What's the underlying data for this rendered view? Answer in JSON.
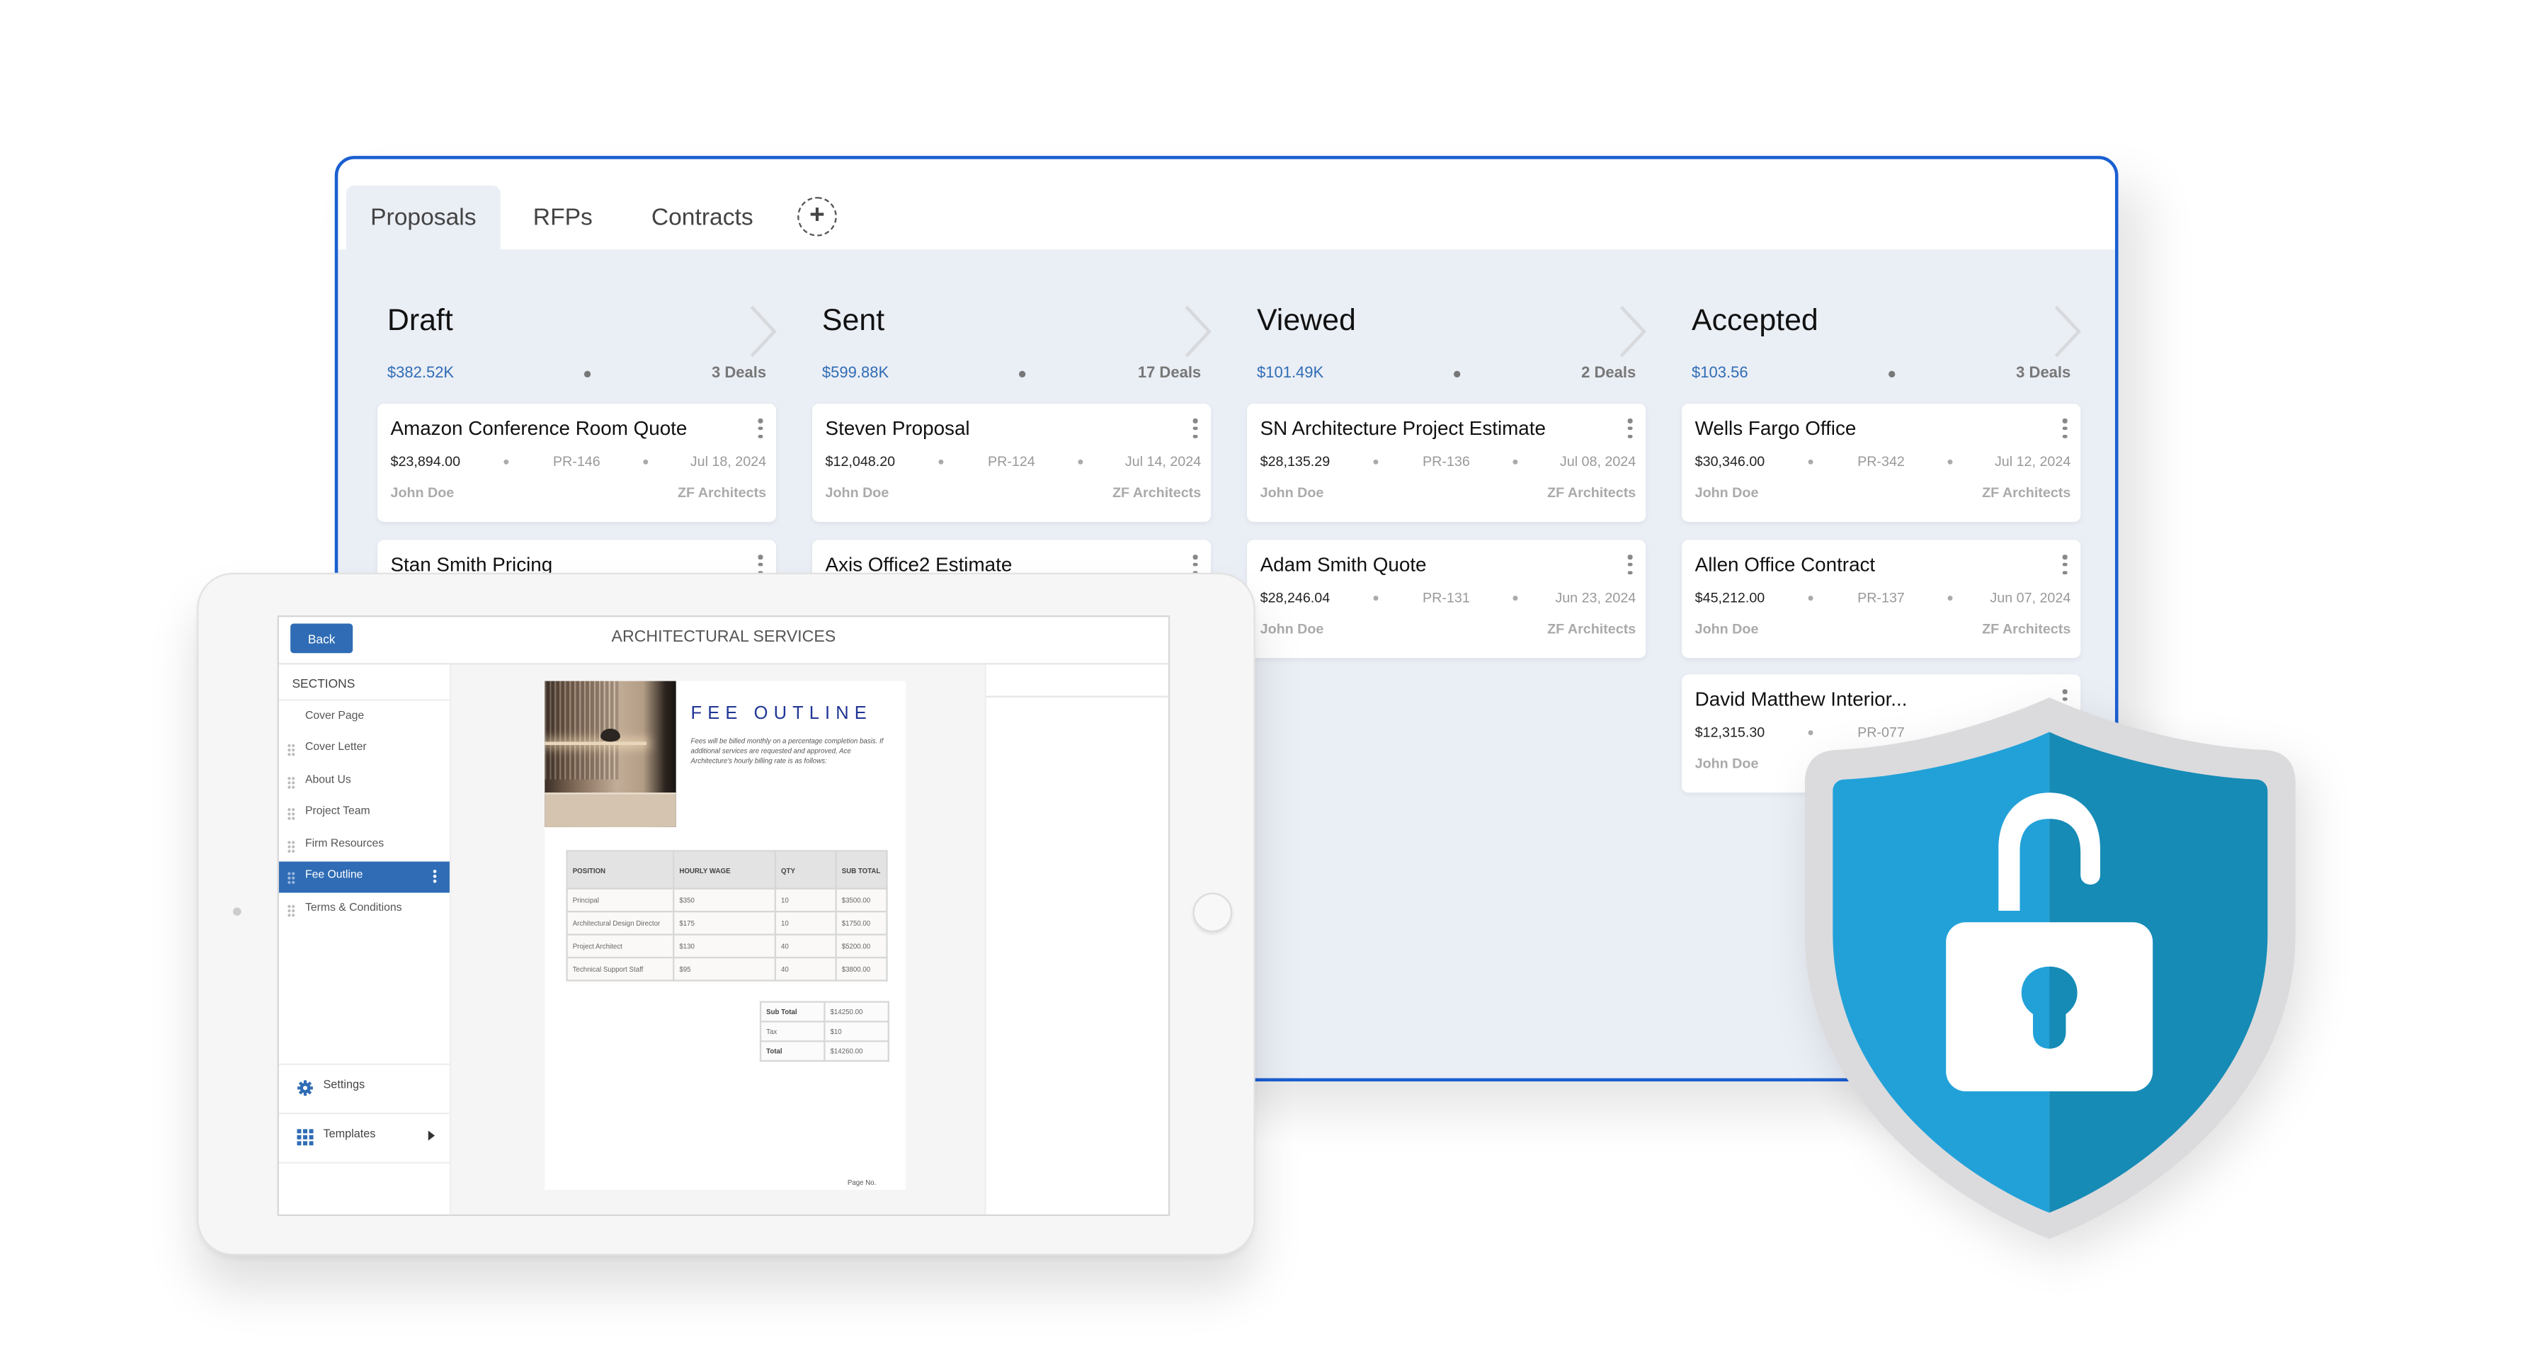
{
  "board": {
    "tabs": [
      {
        "label": "Proposals",
        "active": true
      },
      {
        "label": "RFPs",
        "active": false
      },
      {
        "label": "Contracts",
        "active": false
      }
    ],
    "add_tab_icon": "plus-circle-dashed-icon",
    "columns": [
      {
        "title": "Draft",
        "total": "$382.52K",
        "count": "3 Deals",
        "cards": [
          {
            "title": "Amazon Conference Room Quote",
            "amount": "$23,894.00",
            "code": "PR-146",
            "date": "Jul 18, 2024",
            "owner": "John Doe",
            "company": "ZF Architects"
          },
          {
            "title": "Stan Smith Pricing"
          }
        ]
      },
      {
        "title": "Sent",
        "total": "$599.88K",
        "count": "17 Deals",
        "cards": [
          {
            "title": "Steven Proposal",
            "amount": "$12,048.20",
            "code": "PR-124",
            "date": "Jul 14, 2024",
            "owner": "John Doe",
            "company": "ZF Architects"
          },
          {
            "title": "Axis Office2 Estimate"
          }
        ]
      },
      {
        "title": "Viewed",
        "total": "$101.49K",
        "count": "2 Deals",
        "cards": [
          {
            "title": "SN Architecture Project Estimate",
            "amount": "$28,135.29",
            "code": "PR-136",
            "date": "Jul 08, 2024",
            "owner": "John Doe",
            "company": "ZF Architects"
          },
          {
            "title": "Adam Smith Quote",
            "amount": "$28,246.04",
            "code": "PR-131",
            "date": "Jun 23, 2024",
            "owner": "John Doe",
            "company": "ZF Architects"
          }
        ]
      },
      {
        "title": "Accepted",
        "total": "$103.56",
        "count": "3 Deals",
        "cards": [
          {
            "title": "Wells Fargo Office",
            "amount": "$30,346.00",
            "code": "PR-342",
            "date": "Jul 12, 2024",
            "owner": "John Doe",
            "company": "ZF Architects"
          },
          {
            "title": "Allen Office Contract",
            "amount": "$45,212.00",
            "code": "PR-137",
            "date": "Jun 07, 2024",
            "owner": "John Doe",
            "company": "ZF Architects"
          },
          {
            "title": "David Matthew Interior...",
            "amount": "$12,315.30",
            "code": "PR-077",
            "owner": "John Doe"
          }
        ]
      }
    ]
  },
  "editor": {
    "back_label": "Back",
    "title": "ARCHITECTURAL SERVICES",
    "sections_label": "SECTIONS",
    "sections": [
      {
        "label": "Cover Page",
        "draggable": false
      },
      {
        "label": "Cover Letter",
        "draggable": true
      },
      {
        "label": "About Us",
        "draggable": true
      },
      {
        "label": "Project Team",
        "draggable": true
      },
      {
        "label": "Firm Resources",
        "draggable": true
      },
      {
        "label": "Fee Outline",
        "draggable": true,
        "active": true
      },
      {
        "label": "Terms & Conditions",
        "draggable": true
      }
    ],
    "settings_label": "Settings",
    "templates_label": "Templates",
    "page": {
      "heading": "FEE OUTLINE",
      "paragraph": "Fees will be billed monthly on a percentage completion basis. If additional services are requested and approved, Ace Architecture's hourly billing rate is as follows:",
      "table": {
        "headers": [
          "POSITION",
          "HOURLY WAGE",
          "QTY",
          "SUB TOTAL"
        ],
        "rows": [
          [
            "Principal",
            "$350",
            "10",
            "$3500.00"
          ],
          [
            "Architectural Design Director",
            "$175",
            "10",
            "$1750.00"
          ],
          [
            "Project Architect",
            "$130",
            "40",
            "$5200.00"
          ],
          [
            "Technical Support Staff",
            "$95",
            "40",
            "$3800.00"
          ]
        ]
      },
      "totals": [
        {
          "label": "Sub Total",
          "value": "$14250.00",
          "bold": true
        },
        {
          "label": "Tax",
          "value": "$10",
          "bold": false
        },
        {
          "label": "Total",
          "value": "$14260.00",
          "bold": true
        }
      ],
      "page_no": "Page No."
    }
  },
  "security_badge": {
    "icon": "shield-unlocked-padlock-icon"
  },
  "colors": {
    "accent_blue": "#2f6cb5",
    "window_border": "#1a5fd1",
    "board_bg": "#eaeef5",
    "shield_light": "#22a1d9",
    "shield_dark": "#168bb6",
    "shield_rim": "#dbdbdd",
    "fee_heading": "#1f3594"
  }
}
